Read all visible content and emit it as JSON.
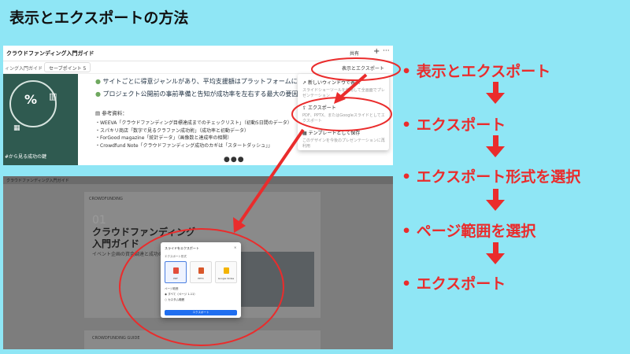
{
  "page": {
    "title": "表示とエクスポートの方法"
  },
  "colors": {
    "background": "#8fe6f5",
    "accent": "#ea2c2c",
    "primary_button": "#1f6ef0",
    "slide_dark": "#2f5a50"
  },
  "top_shot": {
    "doc_title": "クラウドファンディング入門ガイド",
    "share": "共有",
    "plus": "+",
    "more": "···",
    "crumb": "ィング入門ガイド",
    "section_select": "セーブポイント 5",
    "view_export": "表示とエクスポート",
    "left_panel": {
      "percent": "%",
      "key": "#から見る成功の鍵"
    },
    "bullets": [
      "サイトごとに得意ジャンルがあり、平均支援額はプラットフォームによっ",
      "プロジェクト公開前の事前準備と告知が成功率を左右する最大の要因"
    ],
    "ref_title": "参考資料：",
    "refs": [
      "・WEEVA「クラウドファンディング目標達成までのチェックリスト」（初動5日間のデータ）",
      "・スパキリ商店「数字で見るクラファン成功術」（成功率と初動データ）",
      "・ForGood magazine「統計データ」（画像数と達成率の相関）",
      "・Crowdfund Note「クラウドファンディング成功のカギは「スタートダッシュ」」"
    ],
    "pager": "●●●",
    "menu": [
      {
        "title": "新しいウィンドウで表示",
        "desc": "スライドショーツールを使用して全画面でプレゼンテーション"
      },
      {
        "title": "エクスポート",
        "desc": "PDF、PPTX、またはGoogleスライドとしてエクスポート"
      },
      {
        "title": "テンプレートとして保存",
        "desc": "このデザインを今後のプレゼンテーションに再利用"
      }
    ]
  },
  "bottom_shot": {
    "doc_title": "クラウドファンディング入門ガイド",
    "slide_header": "CROWDFUNDING",
    "slide_number": "01",
    "slide_title_1": "クラウドファンディング",
    "slide_title_2": "入門ガイド",
    "slide_sub": "イベント企画の資金調達と成功の鍵",
    "guide_header": "CROWDFUNDING GUIDE",
    "modal": {
      "title": "スライドをエクスポート",
      "close": "×",
      "format_label": "エクスポート形式",
      "formats": [
        "PDF",
        "PPTX",
        "Google Slides"
      ],
      "range_label": "ページ範囲",
      "range_options": [
        "すべて（ページ 1-11）",
        "カスタム範囲"
      ],
      "button": "エクスポート"
    }
  },
  "steps": [
    "• 表示とエクスポート",
    "• エクスポート",
    "• エクスポート形式を選択",
    "• ページ範囲を選択",
    "• エクスポート"
  ]
}
